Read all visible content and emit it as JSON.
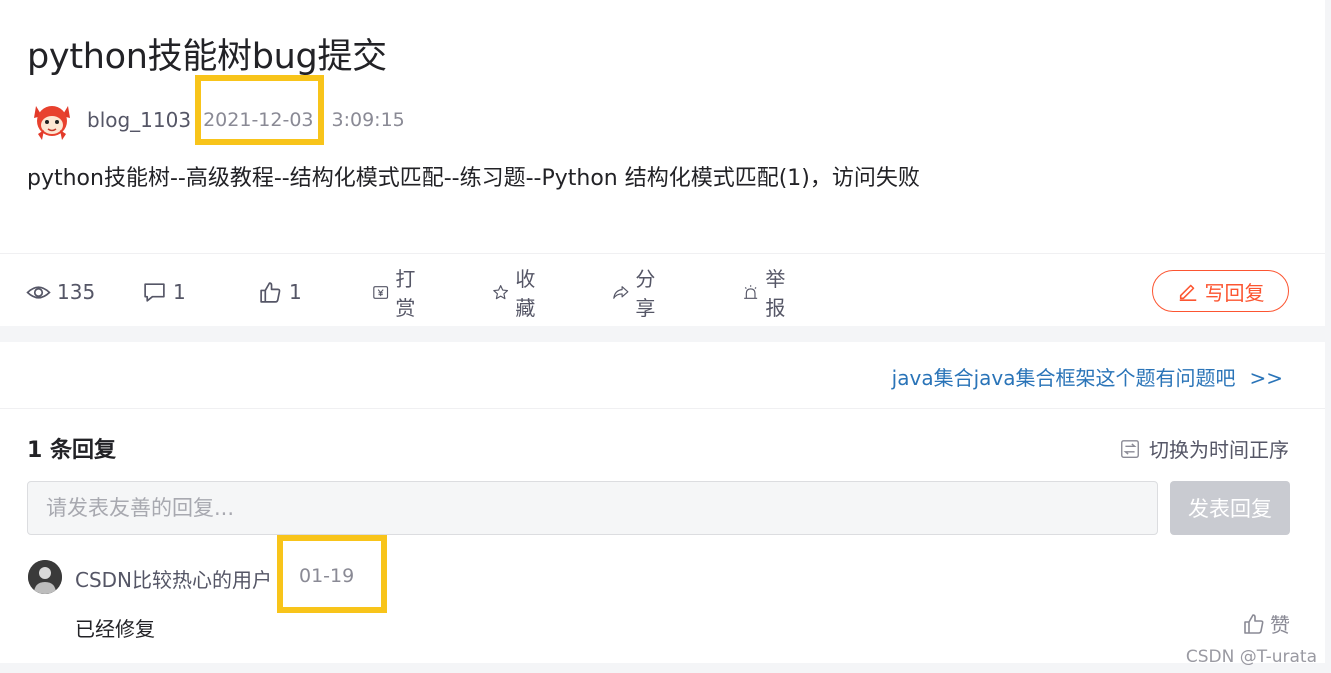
{
  "post": {
    "title": "python技能树bug提交",
    "author": "blog_1103",
    "date": "2021-12-03",
    "time": "3:09:15",
    "body": "python技能树--高级教程--结构化模式匹配--练习题--Python 结构化模式匹配(1)，访问失败"
  },
  "actions": {
    "views": "135",
    "comments": "1",
    "likes": "1",
    "tip": "打赏",
    "favorite": "收藏",
    "share": "分享",
    "report": "举报",
    "reply": "写回复"
  },
  "related": {
    "text": "java集合java集合框架这个题有问题吧",
    "arrow": ">>"
  },
  "replies": {
    "count_label": "1 条回复",
    "sort_label": "切换为时间正序",
    "input_placeholder": "请发表友善的回复...",
    "submit_label": "发表回复",
    "items": [
      {
        "user": "CSDN比较热心的用户",
        "date": "01-19",
        "text": "已经修复",
        "like_label": "赞"
      }
    ]
  },
  "watermark": "CSDN @T-urata",
  "colors": {
    "accent": "#fc5531",
    "link": "#2a74b8",
    "highlight": "#f8c41a"
  }
}
